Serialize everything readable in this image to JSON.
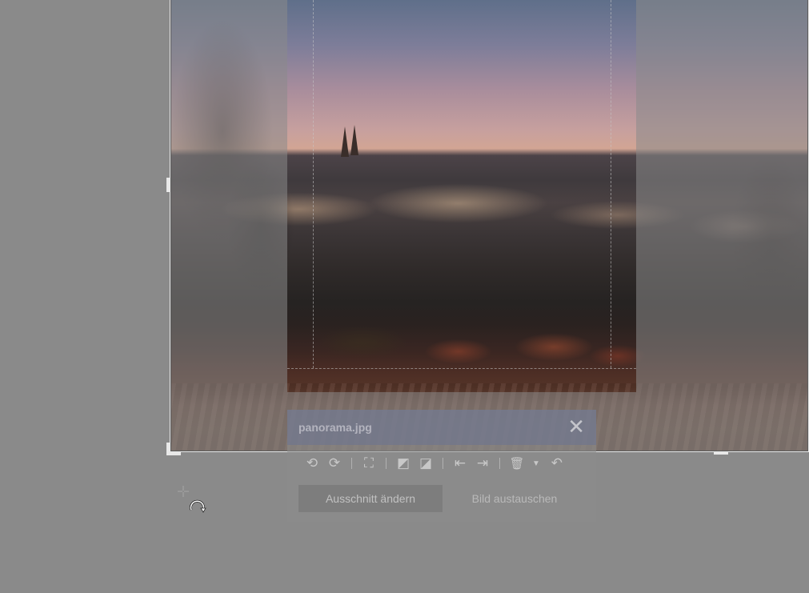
{
  "image_editor": {
    "panel": {
      "title": "panorama.jpg",
      "close_glyph": "✕",
      "toolbar": [
        {
          "name": "rotate-left-icon",
          "glyph": "⟲"
        },
        {
          "name": "rotate-right-icon",
          "glyph": "⟳"
        },
        {
          "name": "fit-icon",
          "glyph": "⛶"
        },
        {
          "name": "bring-forward-icon",
          "glyph": "◩"
        },
        {
          "name": "send-backward-icon",
          "glyph": "◪"
        },
        {
          "name": "align-left-icon",
          "glyph": "⇤"
        },
        {
          "name": "align-right-icon",
          "glyph": "⇥"
        },
        {
          "name": "delete-icon",
          "glyph": "🗑"
        },
        {
          "name": "undo-icon",
          "glyph": "↶"
        }
      ],
      "buttons": {
        "crop_label": "Ausschnitt ändern",
        "replace_label": "Bild austauschen"
      }
    },
    "cursor": {
      "icon": "rotate-cursor-icon"
    },
    "colors": {
      "backdrop": "#8a8a8a",
      "frame": "#e8e8e8",
      "panel_header": "#69739199"
    }
  }
}
